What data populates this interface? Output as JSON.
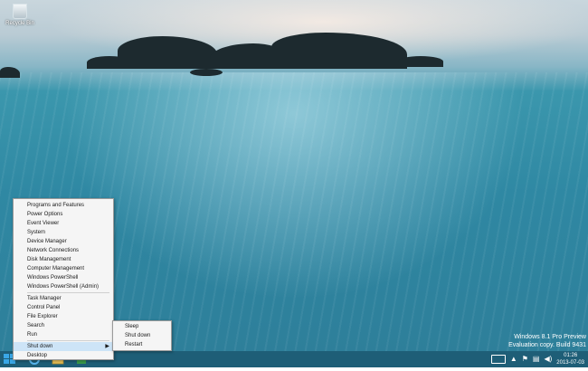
{
  "desktop": {
    "recycle_bin_label": "Recycle Bin",
    "watermark": {
      "line1": "Windows 8.1 Pro Preview",
      "line2": "Evaluation copy. Build 9431"
    }
  },
  "quick_link_menu": {
    "group1": [
      "Programs and Features",
      "Power Options",
      "Event Viewer",
      "System",
      "Device Manager",
      "Network Connections",
      "Disk Management",
      "Computer Management",
      "Windows PowerShell",
      "Windows PowerShell (Admin)"
    ],
    "group2": [
      "Task Manager",
      "Control Panel",
      "File Explorer",
      "Search",
      "Run"
    ],
    "shut_down": "Shut down",
    "desktop": "Desktop"
  },
  "shutdown_submenu": [
    "Sleep",
    "Shut down",
    "Restart"
  ],
  "taskbar": {
    "clock_time": "01:26",
    "clock_date": "2013-07-03",
    "accent_color": "#1e5e77"
  },
  "icons": {
    "start": "windows-logo-icon",
    "ie": "internet-explorer-icon",
    "explorer": "file-explorer-icon",
    "store": "store-icon",
    "keyboard": "touch-keyboard-icon",
    "chevron": "show-hidden-icons",
    "flag": "action-center-flag-icon",
    "network": "network-icon",
    "volume": "volume-icon"
  }
}
